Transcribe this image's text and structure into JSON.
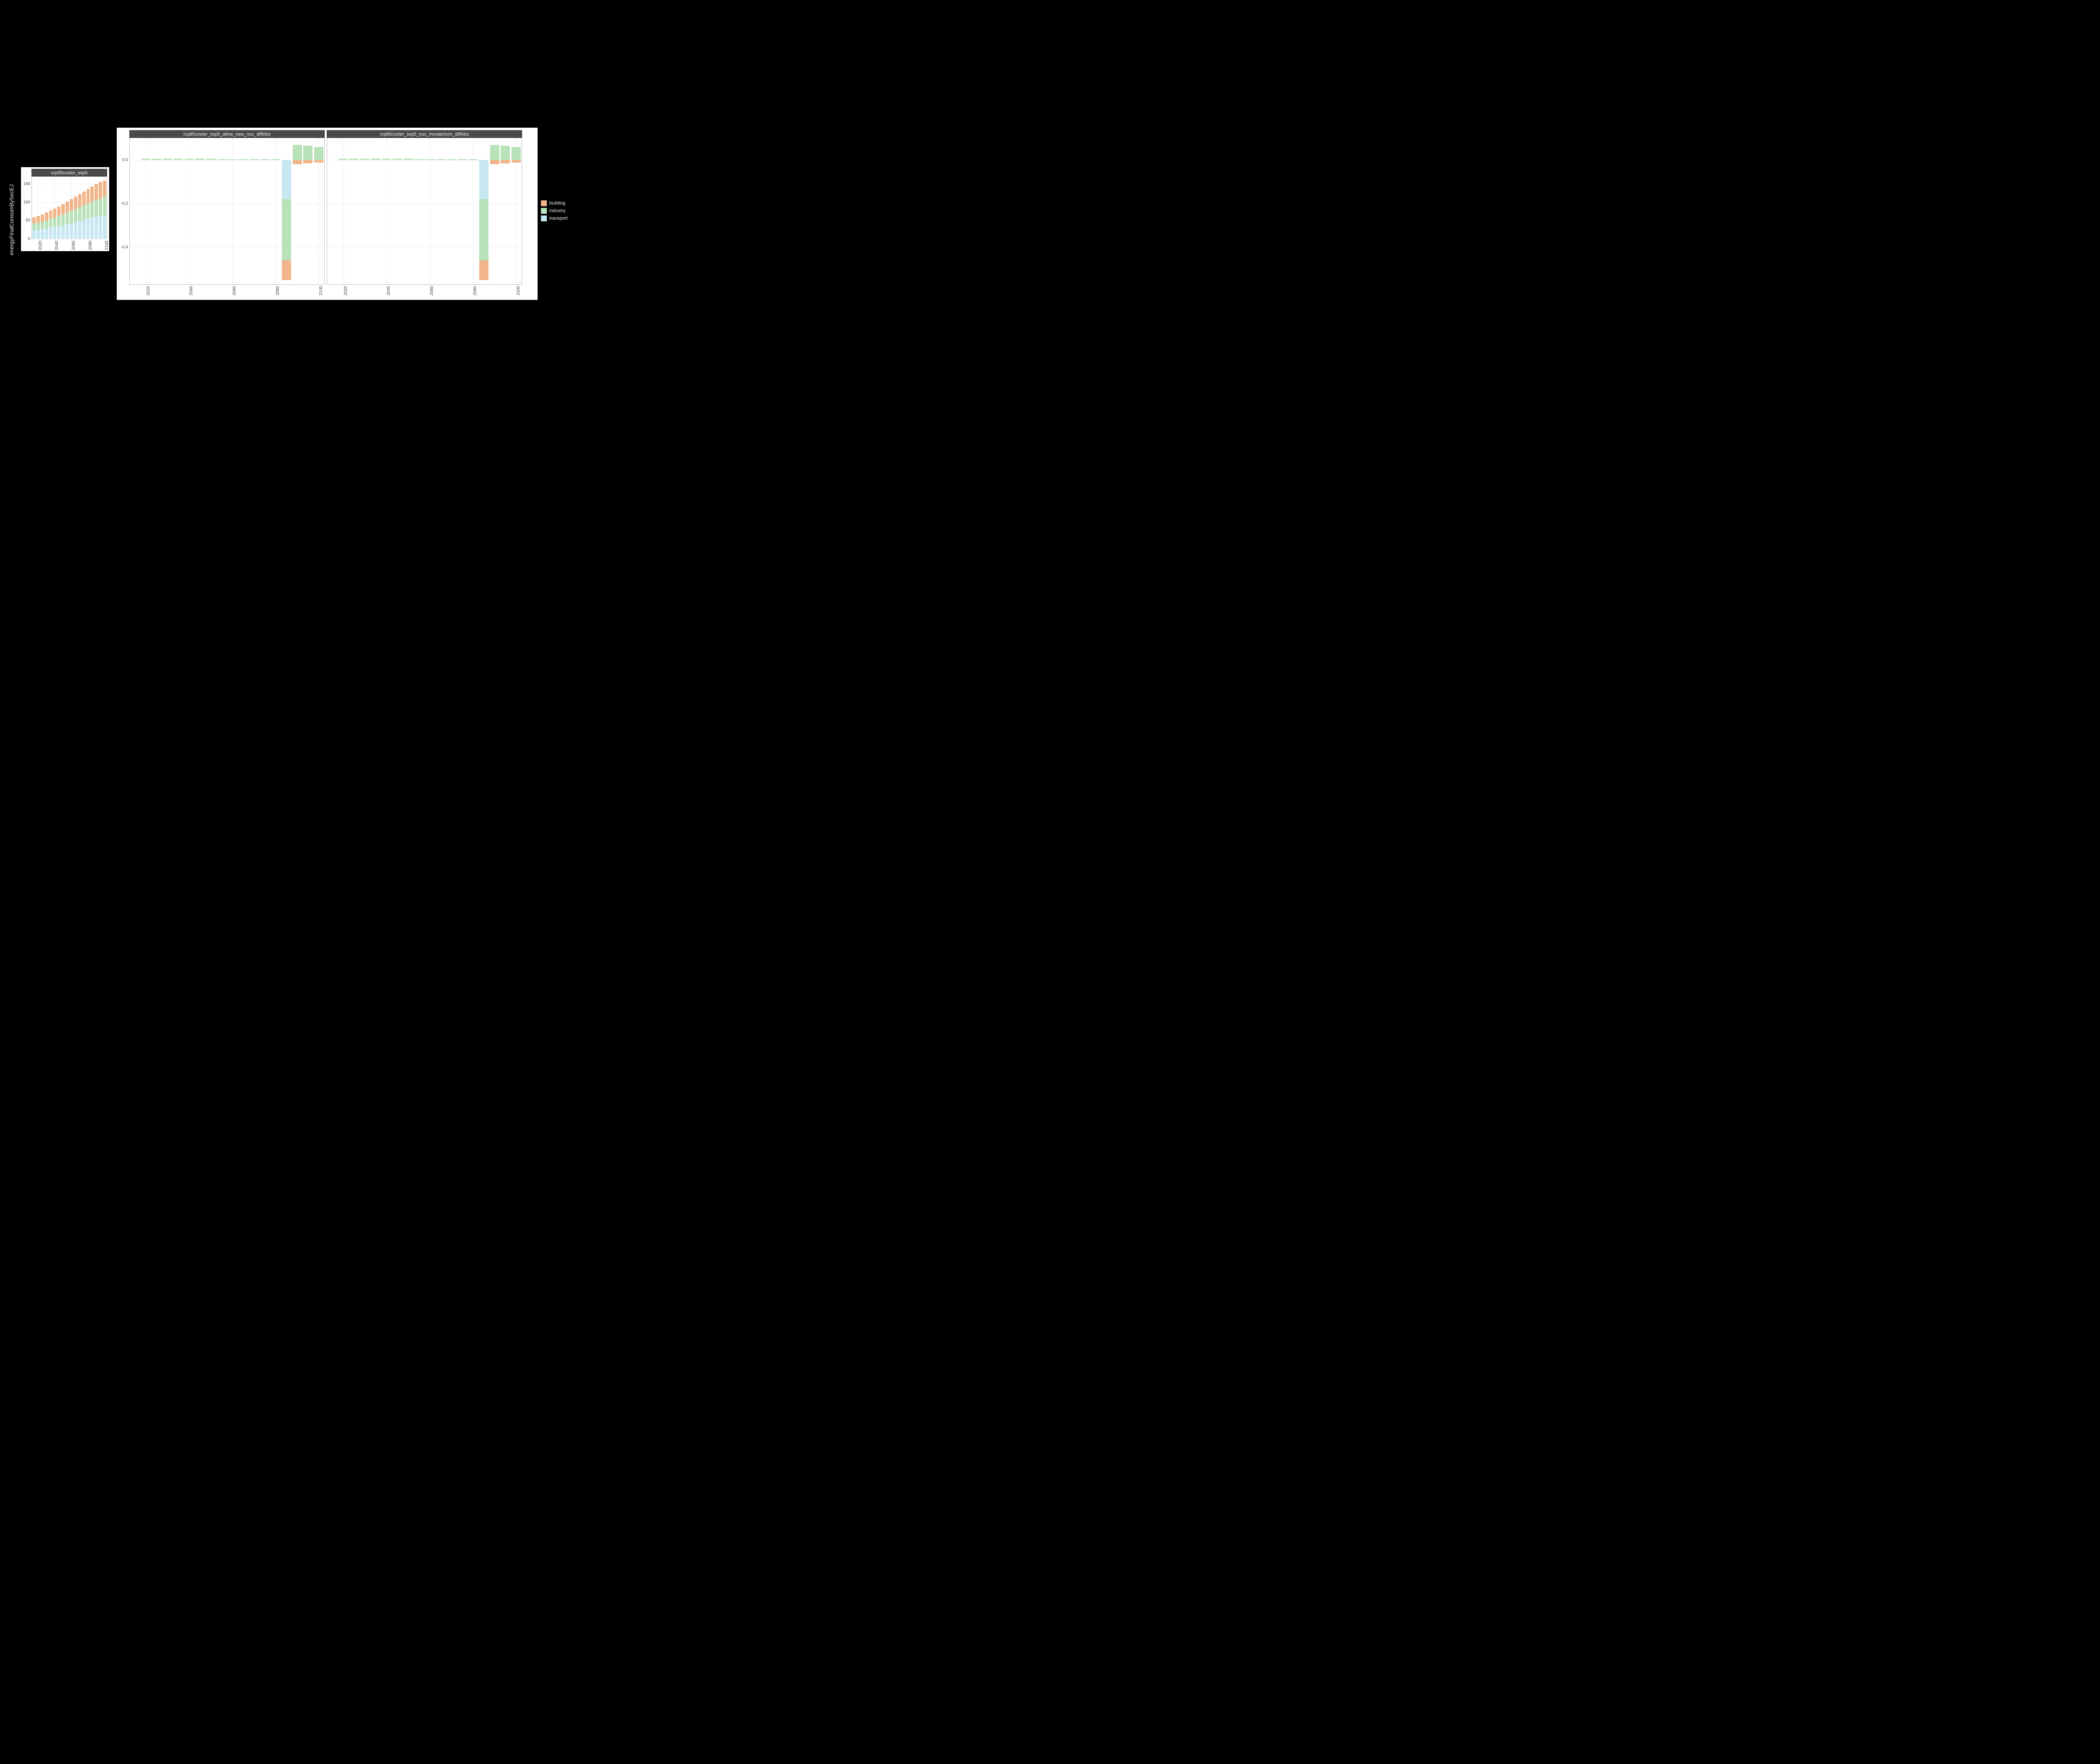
{
  "ylabel": "energyFinalConsumBySecEJ",
  "legend": {
    "items": [
      {
        "key": "building",
        "label": "building"
      },
      {
        "key": "industry",
        "label": "industry"
      },
      {
        "key": "transport",
        "label": "transport"
      }
    ]
  },
  "colors": {
    "building": "#f2b58a",
    "industry": "#b8e2b8",
    "transport": "#c7e7f2"
  },
  "left_panel": {
    "strip": "rcp85cooler_ssp5",
    "y_ticks": [
      0,
      50,
      100,
      150
    ],
    "x_ticks": [
      2020,
      2040,
      2060,
      2080,
      2100
    ],
    "ylim": [
      0,
      170
    ]
  },
  "right_panel": {
    "strips": [
      "rcp85cooler_ssp5_allow_new_nuc_diffAbs",
      "rcp85cooler_ssp5_nuc_moratorium_diffAbs"
    ],
    "y_ticks": [
      0.0,
      -0.2,
      -0.4
    ],
    "x_ticks": [
      2020,
      2040,
      2060,
      2080,
      2100
    ],
    "ylim": [
      -0.57,
      0.1
    ]
  },
  "chart_data": [
    {
      "type": "bar",
      "title": "rcp85cooler_ssp5",
      "ylabel": "energyFinalConsumBySecEJ",
      "ylim": [
        0,
        170
      ],
      "stack_order": [
        "transport",
        "industry",
        "building"
      ],
      "categories": [
        2015,
        2020,
        2025,
        2030,
        2035,
        2040,
        2045,
        2050,
        2055,
        2060,
        2065,
        2070,
        2075,
        2080,
        2085,
        2090,
        2095,
        2100
      ],
      "series": [
        {
          "name": "building",
          "values": [
            18,
            19,
            20,
            21,
            23,
            24,
            26,
            28,
            30,
            32,
            34,
            36,
            38,
            40,
            42,
            44,
            46,
            44
          ]
        },
        {
          "name": "industry",
          "values": [
            18,
            19,
            20,
            22,
            24,
            26,
            28,
            30,
            32,
            34,
            36,
            38,
            40,
            42,
            44,
            46,
            48,
            52
          ]
        },
        {
          "name": "transport",
          "values": [
            24,
            25,
            27,
            29,
            31,
            33,
            35,
            37,
            40,
            43,
            46,
            49,
            52,
            55,
            58,
            61,
            62,
            64
          ]
        }
      ]
    },
    {
      "type": "bar",
      "title": "rcp85cooler_ssp5_allow_new_nuc_diffAbs",
      "ylabel": "energyFinalConsumBySecEJ",
      "ylim": [
        -0.57,
        0.1
      ],
      "stack_order_pos": [
        "transport",
        "industry",
        "building"
      ],
      "stack_order_neg": [
        "transport",
        "industry",
        "building"
      ],
      "categories": [
        2015,
        2020,
        2025,
        2030,
        2035,
        2040,
        2045,
        2050,
        2055,
        2060,
        2065,
        2070,
        2075,
        2080,
        2085,
        2090,
        2095,
        2100
      ],
      "series": [
        {
          "name": "building",
          "values": [
            0.0,
            0.0,
            0.0,
            0.0,
            0.0,
            0.0,
            0.0,
            0.0,
            0.0,
            0.0,
            0.0,
            0.0,
            0.0,
            0.0,
            -0.09,
            -0.02,
            -0.015,
            -0.012
          ]
        },
        {
          "name": "industry",
          "values": [
            0.0,
            0.005,
            0.005,
            0.005,
            0.005,
            0.005,
            0.005,
            0.005,
            0.003,
            0.003,
            0.003,
            0.003,
            0.003,
            0.003,
            -0.28,
            0.07,
            0.065,
            0.06
          ]
        },
        {
          "name": "transport",
          "values": [
            0.0,
            0.0,
            0.0,
            0.0,
            0.0,
            0.0,
            0.0,
            0.0,
            0.0,
            0.0,
            0.0,
            0.0,
            0.0,
            0.0,
            -0.18,
            0.0,
            0.0,
            0.0
          ]
        }
      ]
    },
    {
      "type": "bar",
      "title": "rcp85cooler_ssp5_nuc_moratorium_diffAbs",
      "ylabel": "energyFinalConsumBySecEJ",
      "ylim": [
        -0.57,
        0.1
      ],
      "stack_order_pos": [
        "transport",
        "industry",
        "building"
      ],
      "stack_order_neg": [
        "transport",
        "industry",
        "building"
      ],
      "categories": [
        2015,
        2020,
        2025,
        2030,
        2035,
        2040,
        2045,
        2050,
        2055,
        2060,
        2065,
        2070,
        2075,
        2080,
        2085,
        2090,
        2095,
        2100
      ],
      "series": [
        {
          "name": "building",
          "values": [
            0.0,
            0.0,
            0.0,
            0.0,
            0.0,
            0.0,
            0.0,
            0.0,
            0.0,
            0.0,
            0.0,
            0.0,
            0.0,
            0.0,
            -0.09,
            -0.02,
            -0.015,
            -0.012
          ]
        },
        {
          "name": "industry",
          "values": [
            0.0,
            0.005,
            0.005,
            0.005,
            0.005,
            0.005,
            0.005,
            0.005,
            0.003,
            0.003,
            0.003,
            0.003,
            0.003,
            0.003,
            -0.28,
            0.07,
            0.065,
            0.06
          ]
        },
        {
          "name": "transport",
          "values": [
            0.0,
            0.0,
            0.0,
            0.0,
            0.0,
            0.0,
            0.0,
            0.0,
            0.0,
            0.0,
            0.0,
            0.0,
            0.0,
            0.0,
            -0.18,
            0.0,
            0.0,
            0.0
          ]
        }
      ]
    }
  ]
}
